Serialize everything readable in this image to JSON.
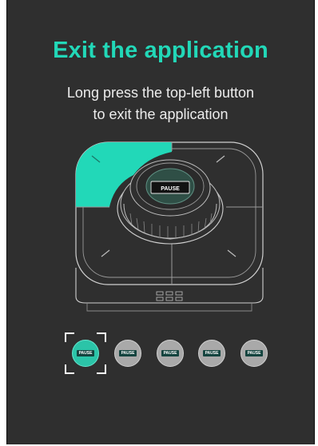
{
  "title": "Exit the application",
  "instruction": {
    "line1": "Long press the top-left button",
    "line2": "to exit the application"
  },
  "device": {
    "center_button_label": "PAUSE",
    "highlighted_button": "top-left"
  },
  "button_thumbnails": [
    {
      "label": "PAUSE",
      "selected": true
    },
    {
      "label": "PAUSE",
      "selected": false
    },
    {
      "label": "PAUSE",
      "selected": false
    },
    {
      "label": "PAUSE",
      "selected": false
    },
    {
      "label": "PAUSE",
      "selected": false
    }
  ],
  "colors": {
    "background": "#2f2f2f",
    "accent": "#22d8b8",
    "text": "#ececec",
    "outline": "#cfcfcf"
  }
}
